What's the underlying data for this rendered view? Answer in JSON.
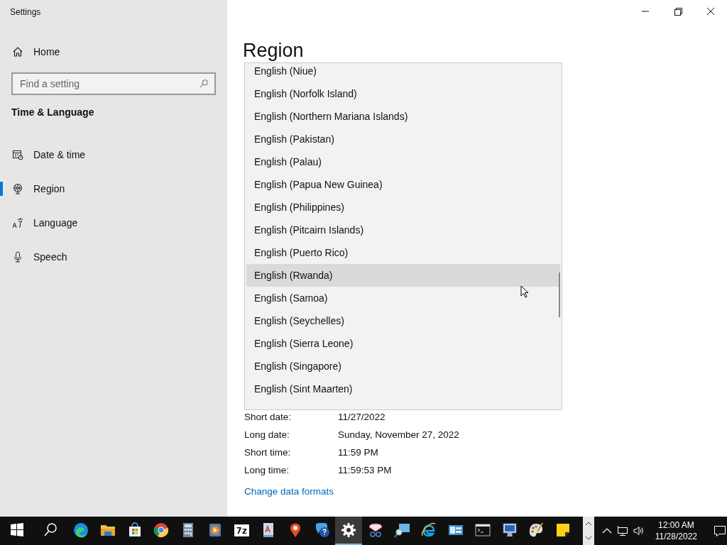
{
  "window": {
    "title": "Settings"
  },
  "sidebar": {
    "home": "Home",
    "search": {
      "placeholder": "Find a setting"
    },
    "section": "Time & Language",
    "items": [
      {
        "label": "Date & time",
        "kind": "calendar",
        "selected": false
      },
      {
        "label": "Region",
        "kind": "globe",
        "selected": true
      },
      {
        "label": "Language",
        "kind": "language",
        "selected": false
      },
      {
        "label": "Speech",
        "kind": "microphone",
        "selected": false
      }
    ]
  },
  "page": {
    "title": "Region",
    "dropdown_list": {
      "items": [
        {
          "label": "English (Niue)",
          "hovered": false
        },
        {
          "label": "English (Norfolk Island)",
          "hovered": false
        },
        {
          "label": "English (Northern Mariana Islands)",
          "hovered": false
        },
        {
          "label": "English (Pakistan)",
          "hovered": false
        },
        {
          "label": "English (Palau)",
          "hovered": false
        },
        {
          "label": "English (Papua New Guinea)",
          "hovered": false
        },
        {
          "label": "English (Philippines)",
          "hovered": false
        },
        {
          "label": "English (Pitcairn Islands)",
          "hovered": false
        },
        {
          "label": "English (Puerto Rico)",
          "hovered": false
        },
        {
          "label": "English (Rwanda)",
          "hovered": true
        },
        {
          "label": "English (Samoa)",
          "hovered": false
        },
        {
          "label": "English (Seychelles)",
          "hovered": false
        },
        {
          "label": "English (Sierra Leone)",
          "hovered": false
        },
        {
          "label": "English (Singapore)",
          "hovered": false
        },
        {
          "label": "English (Sint Maarten)",
          "hovered": false
        }
      ]
    },
    "formats": [
      {
        "label": "Short date:",
        "value": "11/27/2022"
      },
      {
        "label": "Long date:",
        "value": "Sunday, November 27, 2022"
      },
      {
        "label": "Short time:",
        "value": "11:59 PM"
      },
      {
        "label": "Long time:",
        "value": "11:59:53 PM"
      }
    ],
    "link": "Change data formats"
  },
  "taskbar": {
    "apps": [
      {
        "kind": "start",
        "selected": false
      },
      {
        "kind": "search",
        "selected": false
      },
      {
        "kind": "edge",
        "selected": false
      },
      {
        "kind": "folder",
        "selected": false
      },
      {
        "kind": "store",
        "selected": false
      },
      {
        "kind": "chrome",
        "selected": false
      },
      {
        "kind": "calculator",
        "selected": false
      },
      {
        "kind": "media",
        "selected": false
      },
      {
        "kind": "archiver",
        "label": "7z",
        "selected": false
      },
      {
        "kind": "document",
        "selected": false
      },
      {
        "kind": "pin",
        "selected": false
      },
      {
        "kind": "help",
        "selected": false
      },
      {
        "kind": "settings",
        "selected": true
      },
      {
        "kind": "snip",
        "selected": false
      },
      {
        "kind": "magnifier",
        "selected": false
      },
      {
        "kind": "ie",
        "selected": false
      },
      {
        "kind": "panel",
        "selected": false
      },
      {
        "kind": "console",
        "selected": false
      },
      {
        "kind": "remote",
        "selected": false
      },
      {
        "kind": "paint",
        "selected": false
      },
      {
        "kind": "sticky",
        "selected": false
      }
    ],
    "clock": {
      "time": "12:00 AM",
      "date": "11/28/2022"
    }
  }
}
